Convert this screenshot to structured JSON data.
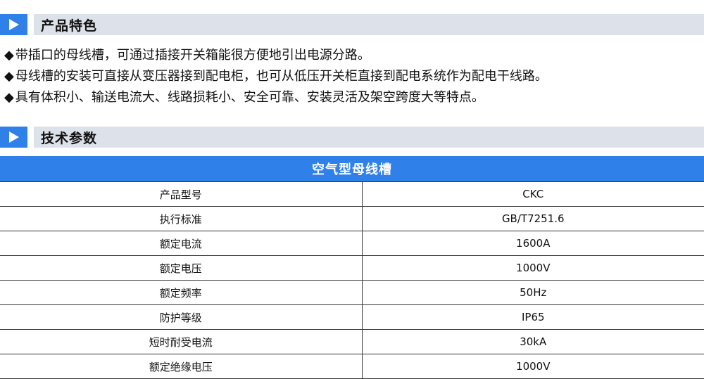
{
  "sections": {
    "features_title": "产品特色",
    "specs_title": "技术参数"
  },
  "colors": {
    "accent": "#2f80e8",
    "section_bar": "#dde1e9"
  },
  "icons": {
    "section_marker": "triangle-right-icon",
    "bullet": "diamond-icon"
  },
  "features": [
    {
      "bullet": "◆",
      "text": "带插口的母线槽，可通过插接开关箱能很方便地引出电源分路。"
    },
    {
      "bullet": "◆",
      "text": "母线槽的安装可直接从变压器接到配电柜，也可从低压开关柜直接到配电系统作为配电干线路。"
    },
    {
      "bullet": "◆",
      "text": "具有体积小、输送电流大、线路损耗小、安全可靠、安装灵活及架空跨度大等特点。"
    }
  ],
  "table": {
    "header": "空气型母线槽",
    "rows": [
      {
        "label": "产品型号",
        "value": "CKC"
      },
      {
        "label": "执行标准",
        "value": "GB/T7251.6"
      },
      {
        "label": "额定电流",
        "value": "1600A"
      },
      {
        "label": "额定电压",
        "value": "1000V"
      },
      {
        "label": "额定频率",
        "value": "50Hz"
      },
      {
        "label": "防护等级",
        "value": "IP65"
      },
      {
        "label": "短时耐受电流",
        "value": "30kA"
      },
      {
        "label": "额定绝缘电压",
        "value": "1000V"
      }
    ]
  }
}
